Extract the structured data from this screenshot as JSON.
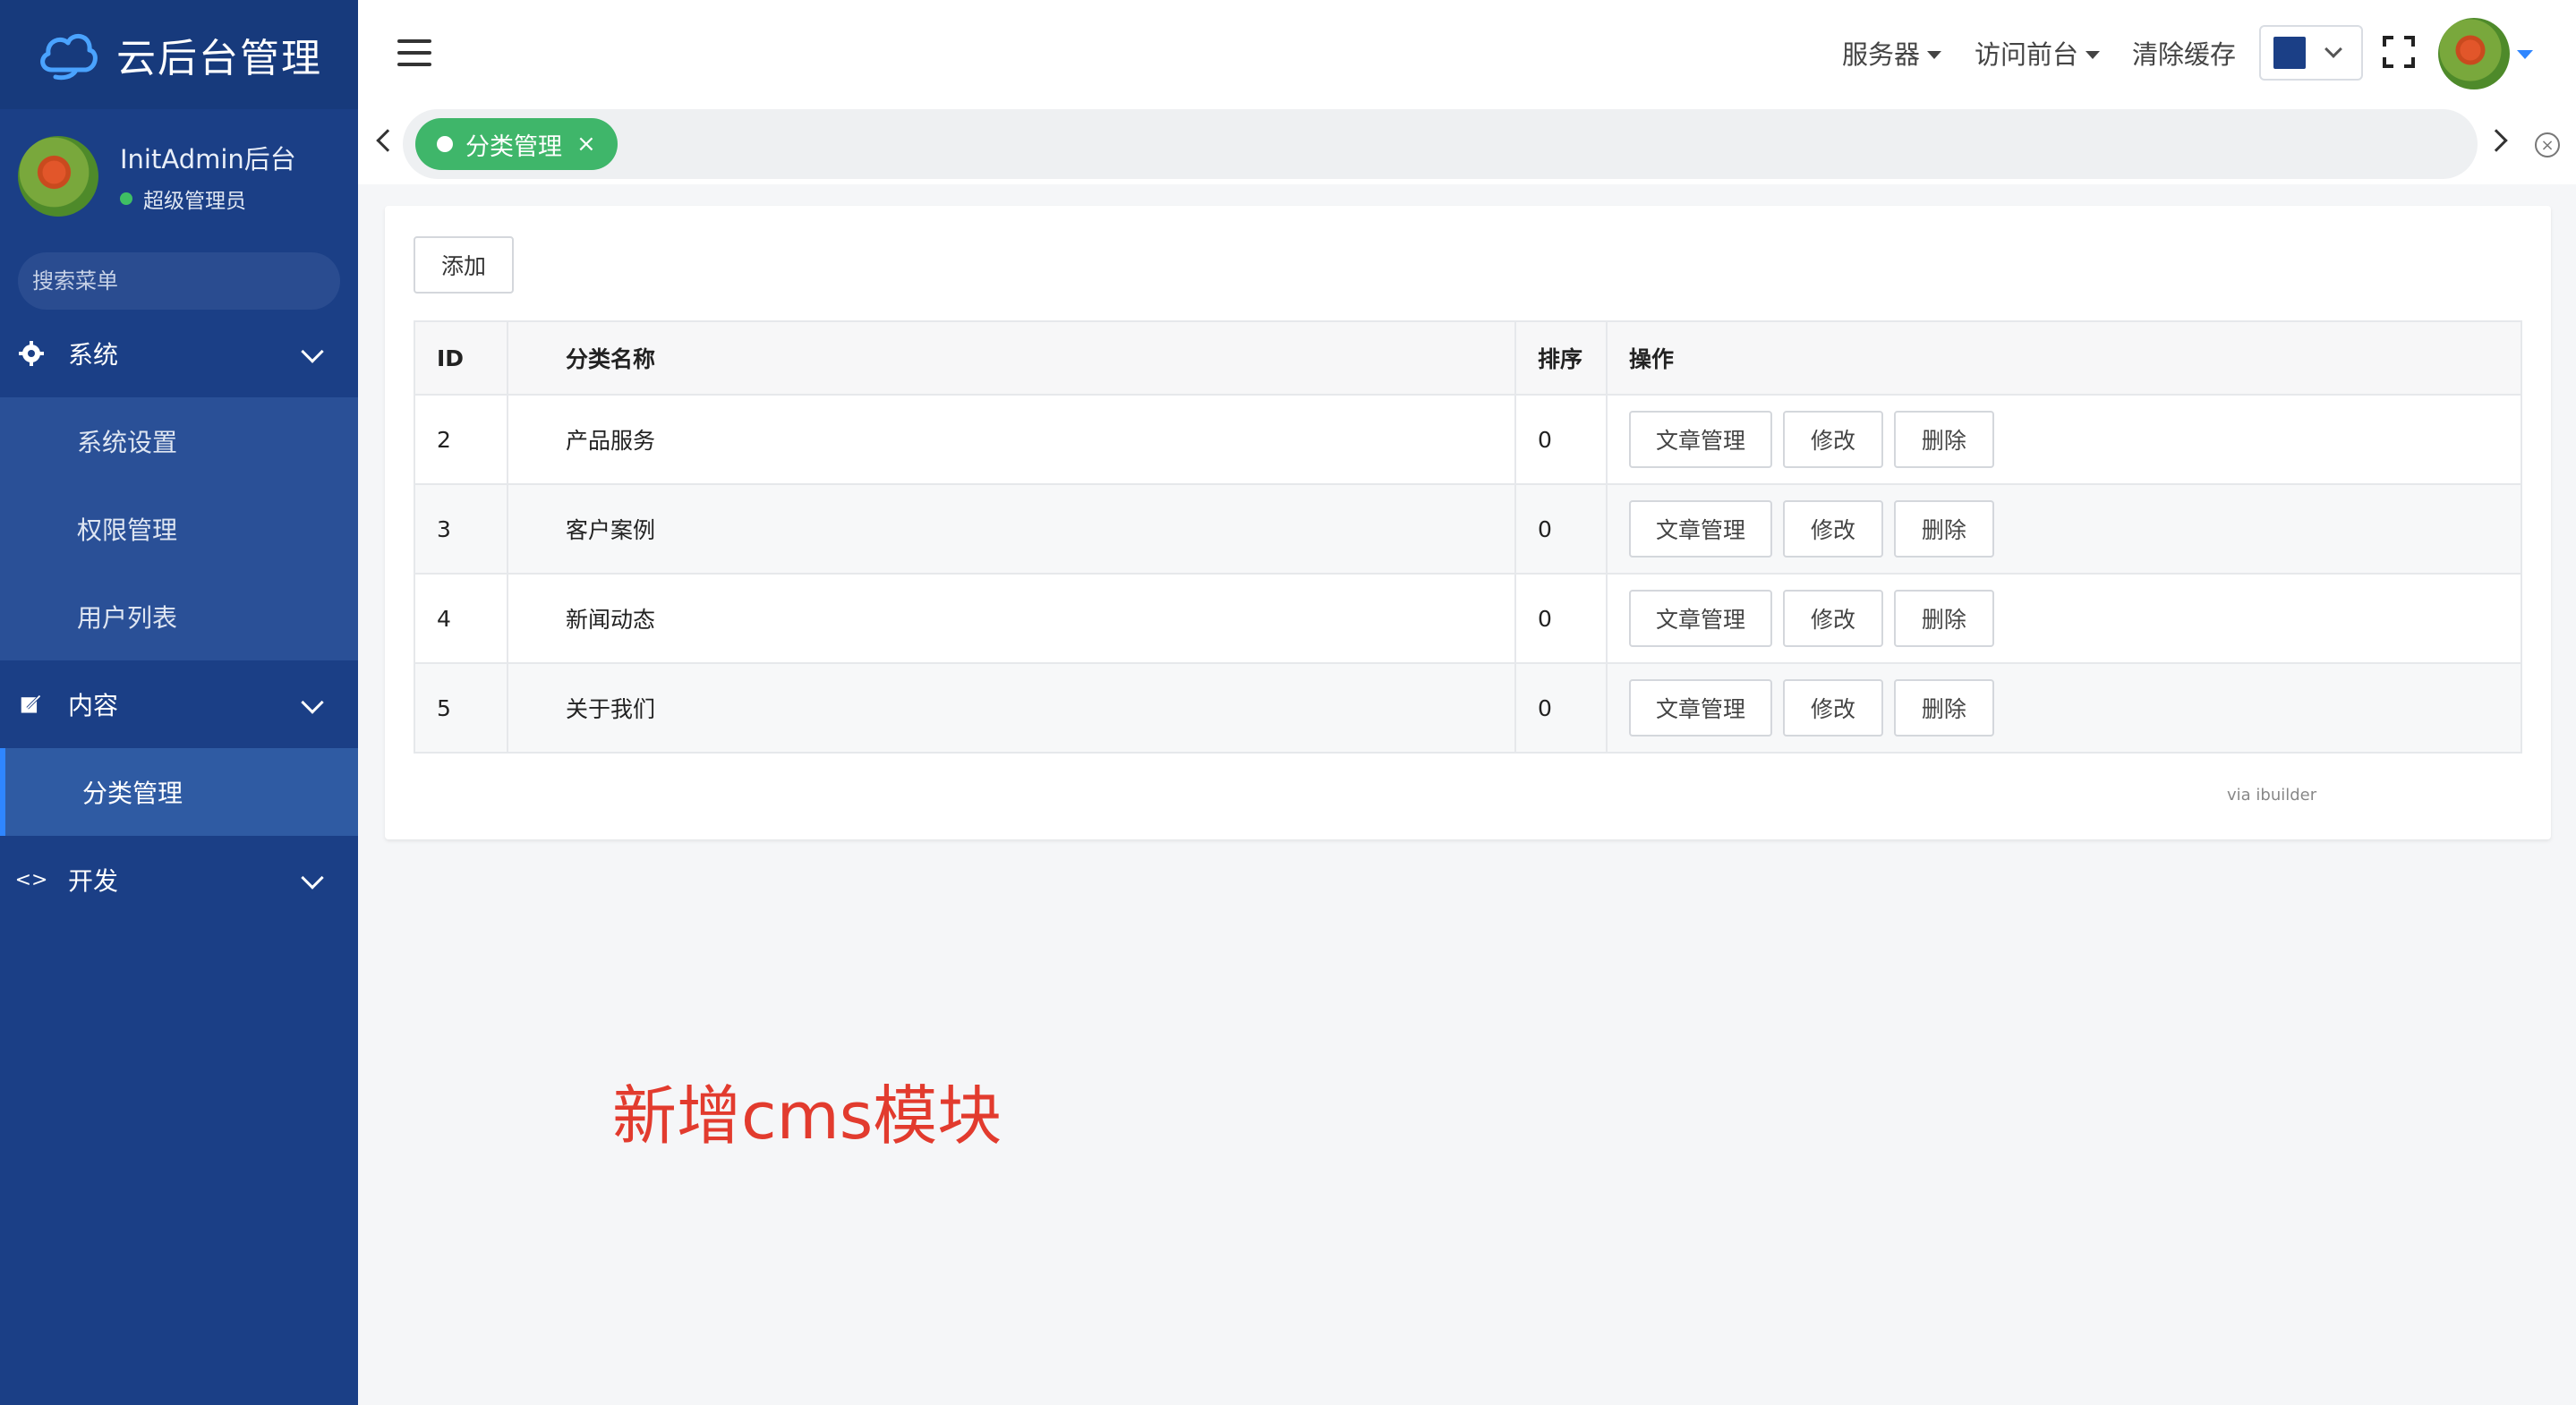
{
  "brand": {
    "title": "云后台管理",
    "logo_icon": "cloud-icon"
  },
  "user": {
    "name": "InitAdmin后台",
    "role": "超级管理员",
    "status_color": "#3fbf63"
  },
  "search": {
    "placeholder": "搜索菜单"
  },
  "menu": {
    "system": {
      "label": "系统",
      "icon": "gear-icon",
      "items": [
        "系统设置",
        "权限管理",
        "用户列表"
      ]
    },
    "content": {
      "label": "内容",
      "icon": "edit-icon",
      "items": [
        "分类管理"
      ]
    },
    "dev": {
      "label": "开发",
      "icon": "code-icon"
    }
  },
  "topbar": {
    "server_label": "服务器",
    "frontend_label": "访问前台",
    "clear_cache_label": "清除缓存",
    "theme_color": "#1b3f86"
  },
  "tabs": {
    "active_label": "分类管理",
    "close_glyph": "×",
    "close_all_glyph": "×"
  },
  "toolbar": {
    "add_label": "添加"
  },
  "table": {
    "headers": {
      "id": "ID",
      "name": "分类名称",
      "sort": "排序",
      "ops": "操作"
    },
    "rows": [
      {
        "id": "2",
        "name": "产品服务",
        "sort": "0"
      },
      {
        "id": "3",
        "name": "客户案例",
        "sort": "0"
      },
      {
        "id": "4",
        "name": "新闻动态",
        "sort": "0"
      },
      {
        "id": "5",
        "name": "关于我们",
        "sort": "0"
      }
    ],
    "op_labels": {
      "article": "文章管理",
      "edit": "修改",
      "delete": "删除"
    }
  },
  "footer": {
    "via": "via ibuilder"
  },
  "annotation": {
    "text": "新增cms模块",
    "color": "#e23b2e"
  },
  "colors": {
    "sidebar": "#1b3f86",
    "accent": "#2f86ff",
    "tab_active": "#3fb66a"
  }
}
